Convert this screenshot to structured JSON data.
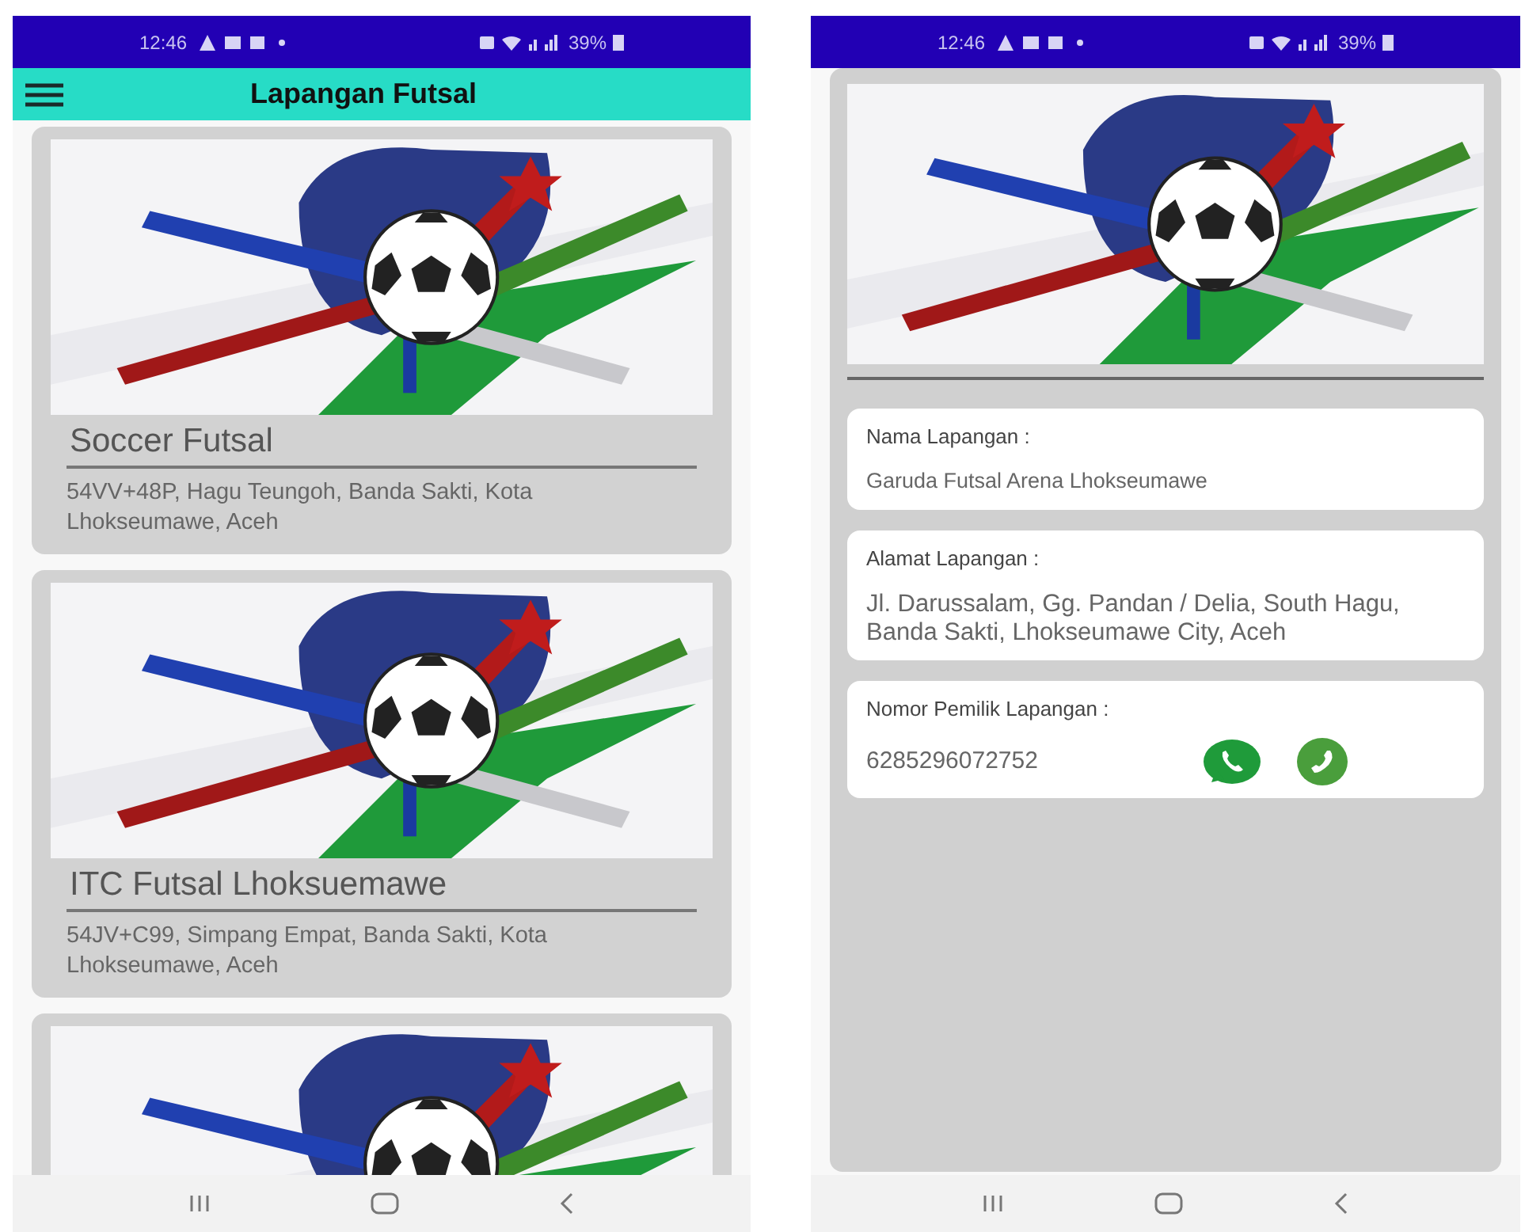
{
  "list_screen": {
    "status_bar": {
      "time": "12:46",
      "battery": "39%"
    },
    "app_bar": {
      "title": "Lapangan Futsal"
    },
    "fields": [
      {
        "kind": "full",
        "name": "Soccer Futsal",
        "address": "54VV+48P, Hagu Teungoh, Banda Sakti, Kota Lhokseumawe, Aceh"
      },
      {
        "kind": "full",
        "name": "ITC Futsal Lhoksuemawe",
        "address": "54JV+C99, Simpang Empat, Banda Sakti, Kota Lhokseumawe, Aceh"
      },
      {
        "kind": "image_only"
      }
    ]
  },
  "detail_screen": {
    "status_bar": {
      "time": "12:46",
      "battery": "39%"
    },
    "info_cards": [
      {
        "label": "Nama Lapangan :",
        "value": "Garuda Futsal Arena Lhokseumawe"
      },
      {
        "label": "Alamat Lapangan :",
        "value": "Jl. Darussalam, Gg. Pandan / Delia, South Hagu, Banda Sakti, Lhokseumawe City, Aceh"
      },
      {
        "label": "Nomor Pemilik Lapangan :",
        "value": "6285296072752",
        "kind": "phone"
      }
    ]
  }
}
